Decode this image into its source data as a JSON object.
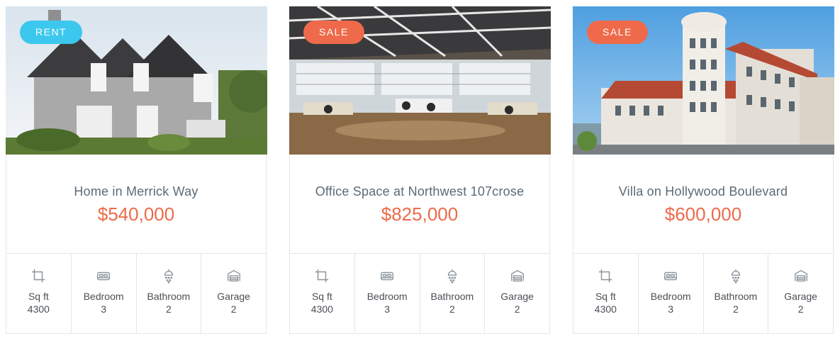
{
  "colors": {
    "rent": "#3cc8ee",
    "sale": "#ee6a4a",
    "price": "#ee6a4a",
    "title": "#5c6b78",
    "icon": "#8a949c"
  },
  "listings": [
    {
      "badge": "RENT",
      "badge_type": "rent",
      "image": "house-photo",
      "title": "Home in Merrick Way",
      "price": "$540,000",
      "features": [
        {
          "icon": "crop-icon",
          "label": "Sq ft",
          "value": "4300"
        },
        {
          "icon": "bed-icon",
          "label": "Bedroom",
          "value": "3"
        },
        {
          "icon": "shower-icon",
          "label": "Bathroom",
          "value": "2"
        },
        {
          "icon": "garage-icon",
          "label": "Garage",
          "value": "2"
        }
      ]
    },
    {
      "badge": "SALE",
      "badge_type": "sale",
      "image": "office-photo",
      "title": "Office Space at Northwest 107crose",
      "price": "$825,000",
      "features": [
        {
          "icon": "crop-icon",
          "label": "Sq ft",
          "value": "4300"
        },
        {
          "icon": "bed-icon",
          "label": "Bedroom",
          "value": "3"
        },
        {
          "icon": "shower-icon",
          "label": "Bathroom",
          "value": "2"
        },
        {
          "icon": "garage-icon",
          "label": "Garage",
          "value": "2"
        }
      ]
    },
    {
      "badge": "SALE",
      "badge_type": "sale",
      "image": "villa-photo",
      "title": "Villa on Hollywood Boulevard",
      "price": "$600,000",
      "features": [
        {
          "icon": "crop-icon",
          "label": "Sq ft",
          "value": "4300"
        },
        {
          "icon": "bed-icon",
          "label": "Bedroom",
          "value": "3"
        },
        {
          "icon": "shower-icon",
          "label": "Bathroom",
          "value": "2"
        },
        {
          "icon": "garage-icon",
          "label": "Garage",
          "value": "2"
        }
      ]
    }
  ]
}
